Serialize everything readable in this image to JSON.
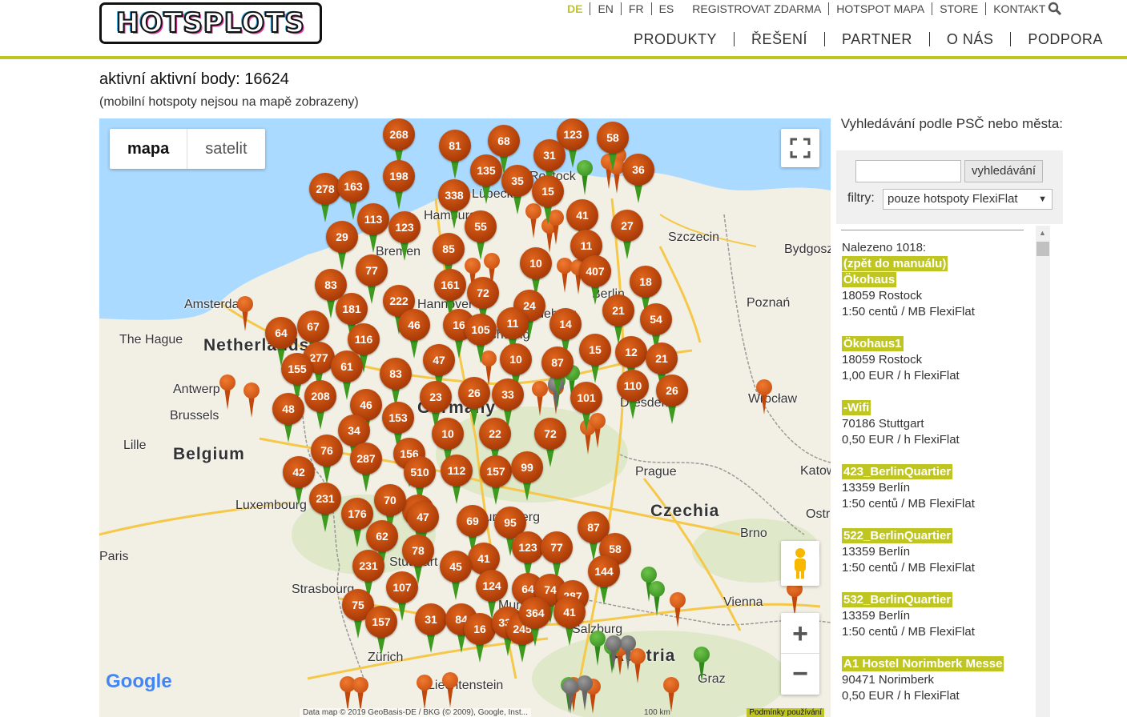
{
  "header": {
    "logo_text": "HOTSPLOTS",
    "top_nav": [
      "DE",
      "EN",
      "FR",
      "ES",
      "REGISTROVAT ZDARMA",
      "HOTSPOT MAPA",
      "STORE",
      "KONTAKT"
    ],
    "main_nav": [
      "PRODUKTY",
      "ŘEŠENÍ",
      "PARTNER",
      "O NÁS",
      "PODPORA"
    ]
  },
  "page": {
    "title": "aktivní aktivní body: 16624",
    "subtitle": "(mobilní hotspoty nejsou na mapě zobrazeny)"
  },
  "map": {
    "type_buttons": [
      "mapa",
      "satelit"
    ],
    "zoom_in": "+",
    "zoom_out": "−",
    "attribution": "Data map © 2019 GeoBasis-DE / BKG (© 2009), Google, Inst...",
    "scale": "100 km",
    "terms": "Podmínky používání",
    "google": "Google",
    "cities": [
      "Amsterdam",
      "The Hague",
      "Antwerp",
      "Brussels",
      "Lille",
      "Luxembourg",
      "Paris",
      "Strasbourg",
      "Zürich",
      "Liechtenstein",
      "Hamburg",
      "Lübeck",
      "Rostock",
      "Bremen",
      "Hannover",
      "Braunschweig",
      "Magdeburg",
      "Berlin",
      "Dresden",
      "Prague",
      "Brno",
      "Vienna",
      "Graz",
      "Salzburg",
      "Munich",
      "Stuttgart",
      "Nuremberg",
      "Szczecin",
      "Bydgoszcz",
      "Poznań",
      "Wrocław",
      "Katowice",
      "Ostrava"
    ],
    "countries": [
      "Netherlands",
      "Belgium",
      "Germany",
      "Czechia",
      "Austria"
    ],
    "clusters": [
      "268",
      "81",
      "68",
      "123",
      "58",
      "31",
      "36",
      "278",
      "163",
      "198",
      "135",
      "35",
      "15",
      "338",
      "41",
      "27",
      "29",
      "113",
      "123",
      "55",
      "85",
      "11",
      "77",
      "10",
      "407",
      "83",
      "161",
      "72",
      "222",
      "18",
      "181",
      "24",
      "21",
      "54",
      "64",
      "67",
      "46",
      "16",
      "105",
      "11",
      "14",
      "116",
      "277",
      "47",
      "10",
      "87",
      "15",
      "12",
      "21",
      "155",
      "61",
      "83",
      "26",
      "33",
      "110",
      "26",
      "48",
      "208",
      "46",
      "23",
      "101",
      "153",
      "10",
      "72",
      "22",
      "34",
      "76",
      "287",
      "156",
      "510",
      "112",
      "157",
      "99",
      "42",
      "35",
      "231",
      "70",
      "176",
      "47",
      "69",
      "95",
      "87",
      "62",
      "123",
      "77",
      "58",
      "78",
      "41",
      "231",
      "45",
      "144",
      "107",
      "124",
      "64",
      "74",
      "287",
      "75",
      "157",
      "31",
      "84",
      "16",
      "334",
      "245",
      "364",
      "41",
      "45"
    ]
  },
  "sidebar": {
    "search_label": "Vyhledávání podle PSČ nebo města:",
    "search_placeholder": "",
    "search_button": "vyhledávání",
    "filter_label": "filtry:",
    "filter_value": "pouze hotspoty FlexiFlat",
    "found": "Nalezeno 1018:",
    "back_link": "(zpět do manuálu)",
    "results": [
      {
        "name": "Ökohaus",
        "city": "18059 Rostock",
        "price": "1:50 centů / MB FlexiFlat"
      },
      {
        "name": "Ökohaus1",
        "city": "18059 Rostock",
        "price": "1,00 EUR / h FlexiFlat"
      },
      {
        "name": "-Wifi",
        "city": "70186 Stuttgart",
        "price": "0,50 EUR / h FlexiFlat"
      },
      {
        "name": "423_BerlinQuartier",
        "city": "13359 Berlín",
        "price": "1:50 centů / MB FlexiFlat"
      },
      {
        "name": "522_BerlinQuartier",
        "city": "13359 Berlín",
        "price": "1:50 centů / MB FlexiFlat"
      },
      {
        "name": "532_BerlinQuartier",
        "city": "13359 Berlín",
        "price": "1:50 centů / MB FlexiFlat"
      },
      {
        "name": "A1 Hostel Norimberk Messe",
        "city": "90471 Norimberk",
        "price": "0,50 EUR / h FlexiFlat"
      }
    ]
  }
}
